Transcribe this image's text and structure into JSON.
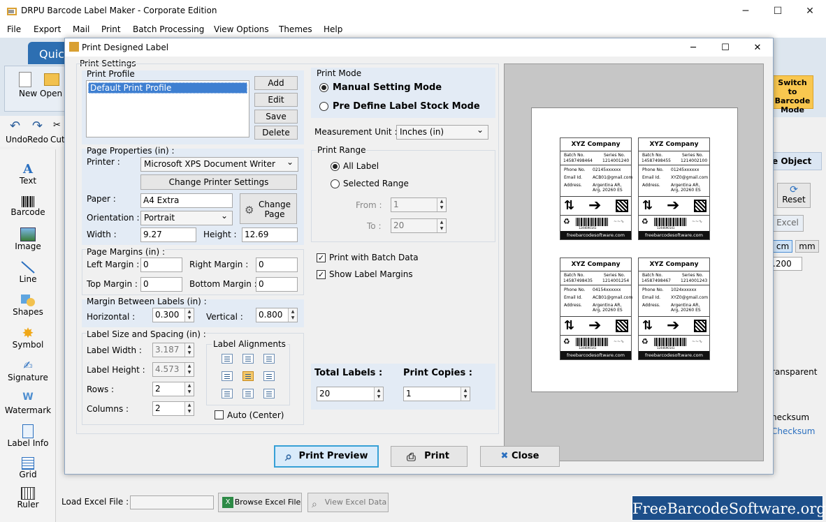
{
  "app": {
    "title": "DRPU Barcode Label Maker - Corporate Edition",
    "menu": [
      "File",
      "Export",
      "Mail",
      "Print",
      "Batch Processing",
      "View Options",
      "Themes",
      "Help"
    ],
    "quick_tab": "Quic",
    "ribbon": {
      "new": "New",
      "open": "Open",
      "switch_line1": "Switch to",
      "switch_line2": "Barcode",
      "switch_line3": "Mode"
    },
    "undo_bar": {
      "undo": "Undo",
      "redo": "Redo",
      "cut": "Cut"
    },
    "tools": [
      "Text",
      "Barcode",
      "Image",
      "Line",
      "Shapes",
      "Symbol",
      "Signature",
      "Watermark",
      "Label Info",
      "Grid",
      "Ruler"
    ],
    "right_panel": {
      "object": "e Object",
      "reset": "Reset",
      "excel": "Excel",
      "cm": "cm",
      "mm": "mm",
      "value": ".200",
      "transparent": "ransparent",
      "checksum1": "hecksum",
      "checksum2": "Checksum"
    },
    "bottom": {
      "load_excel": "Load Excel File :",
      "browse": "Browse Excel File",
      "view": "View Excel Data"
    },
    "banner": "FreeBarcodeSoftware.org"
  },
  "dialog": {
    "title": "Print Designed Label",
    "print_settings": "Print Settings",
    "print_profile": {
      "legend": "Print Profile",
      "items": [
        "Default Print Profile"
      ],
      "selected": 0,
      "buttons": [
        "Add",
        "Edit",
        "Save",
        "Delete"
      ]
    },
    "page_properties": {
      "legend": "Page Properties (in) :",
      "printer_label": "Printer :",
      "printer": "Microsoft XPS Document Writer",
      "change_printer": "Change Printer Settings",
      "paper_label": "Paper :",
      "paper": "A4 Extra",
      "change_page_1": "Change",
      "change_page_2": "Page",
      "orientation_label": "Orientation :",
      "orientation": "Portrait",
      "width_label": "Width :",
      "width": "9.27",
      "height_label": "Height :",
      "height": "12.69"
    },
    "page_margins": {
      "legend": "Page Margins (in) :",
      "left_label": "Left Margin :",
      "left": "0",
      "right_label": "Right Margin :",
      "right": "0",
      "top_label": "Top Margin :",
      "top": "0",
      "bottom_label": "Bottom Margin :",
      "bottom": "0"
    },
    "margin_between": {
      "legend": "Margin Between Labels (in) :",
      "horizontal_label": "Horizontal :",
      "horizontal": "0.300",
      "vertical_label": "Vertical :",
      "vertical": "0.800"
    },
    "label_size": {
      "legend": "Label Size and Spacing (in) :",
      "width_label": "Label Width :",
      "width": "3.187",
      "height_label": "Label Height :",
      "height": "4.573",
      "rows_label": "Rows :",
      "rows": "2",
      "columns_label": "Columns :",
      "columns": "2",
      "alignments_legend": "Label Alignments",
      "auto_center": "Auto (Center)"
    },
    "print_mode": {
      "legend": "Print Mode",
      "manual": "Manual Setting Mode",
      "predefine": "Pre Define Label Stock Mode",
      "selected": "manual"
    },
    "measurement": {
      "label": "Measurement Unit :",
      "value": "Inches (in)"
    },
    "print_range": {
      "legend": "Print Range",
      "all": "All Label",
      "selected_range": "Selected Range",
      "from_label": "From :",
      "from": "1",
      "to_label": "To :",
      "to": "20"
    },
    "batch": "Print with Batch Data",
    "show_margins": "Show Label Margins",
    "totals": {
      "total_label": "Total Labels :",
      "total": "20",
      "copies_label": "Print Copies :",
      "copies": "1"
    },
    "buttons": {
      "preview": "Print Preview",
      "print": "Print",
      "close": "Close"
    }
  },
  "preview_labels": [
    {
      "company": "XYZ Company",
      "batch": "14587498464",
      "series": "1214001240",
      "phone": "02145xxxxxx",
      "email": "ACB01@gmail.com",
      "address": "Argentina AR, Arg, 20260 ES"
    },
    {
      "company": "XYZ Company",
      "batch": "14587498455",
      "series": "1214002100",
      "phone": "01245xxxxxx",
      "email": "XYZ0@gmail.com",
      "address": "Argentina AR, Arg, 20260 ES"
    },
    {
      "company": "XYZ Company",
      "batch": "14587498435",
      "series": "1214001254",
      "phone": "04154xxxxxx",
      "email": "ACB01@gmail.com",
      "address": "Argentina AR, Arg, 20260 ES"
    },
    {
      "company": "XYZ Company",
      "batch": "14587498467",
      "series": "1214001243",
      "phone": "1024xxxxxx",
      "email": "XYZ0@gmail.com",
      "address": "Argentina AR, Arg, 20260 ES"
    }
  ],
  "label_template": {
    "batch_label": "Batch No.",
    "series_label": "Series No.",
    "phone_label": "Phone No.",
    "email_label": "Email Id.",
    "address_label": "Address.",
    "footer": "freebarcodesoftware.com",
    "barcode_text": "1244690141"
  }
}
